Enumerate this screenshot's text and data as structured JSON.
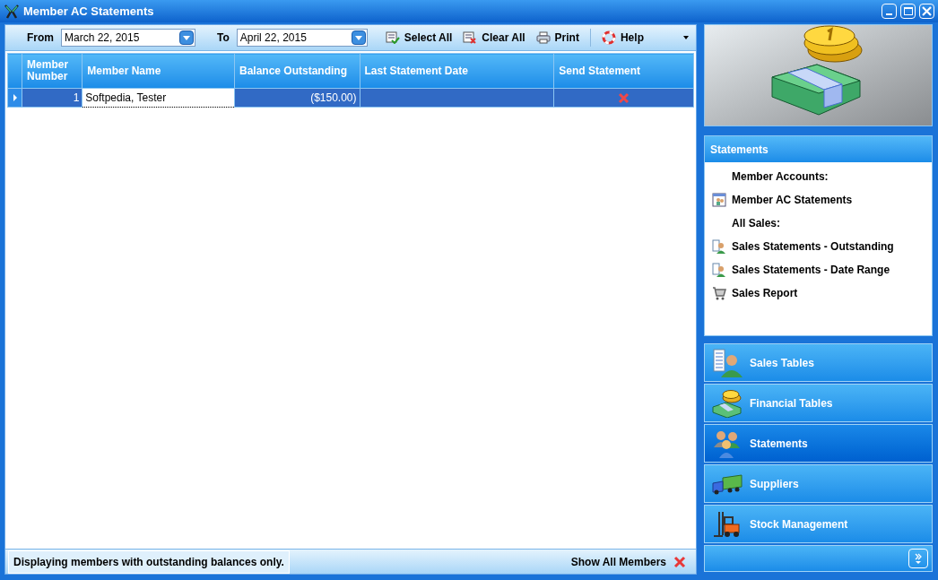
{
  "window": {
    "title": "Member AC Statements"
  },
  "toolbar": {
    "from_label": "From",
    "from_value": "March 22, 2015",
    "to_label": "To",
    "to_value": "April 22, 2015",
    "buttons": [
      {
        "kind": "select",
        "label": "Select All"
      },
      {
        "kind": "clear",
        "label": "Clear All"
      },
      {
        "kind": "print",
        "label": "Print"
      },
      {
        "kind": "help",
        "label": "Help"
      }
    ]
  },
  "table": {
    "columns": [
      "Member Number",
      "Member Name",
      "Balance Outstanding",
      "Last Statement Date",
      "Send Statement"
    ],
    "rows": [
      {
        "selected": true,
        "member_number": "1",
        "member_name": "Softpedia, Tester",
        "balance": "($150.00)",
        "last_statement_date": "",
        "send_statement": false
      }
    ]
  },
  "status_bar": {
    "message": "Displaying members with outstanding balances only.",
    "show_all": "Show All Members"
  },
  "statements_panel": {
    "title": "Statements",
    "items": [
      {
        "kind": "heading",
        "label": "Member Accounts:"
      },
      {
        "kind": "statement",
        "label": "Member AC Statements"
      },
      {
        "kind": "heading",
        "label": "All Sales:"
      },
      {
        "kind": "sales",
        "label": "Sales Statements - Outstanding"
      },
      {
        "kind": "sales",
        "label": "Sales Statements - Date Range"
      },
      {
        "kind": "cart",
        "label": "Sales Report"
      }
    ]
  },
  "nav_buttons": [
    {
      "kind": "sales",
      "label": "Sales Tables",
      "selected": false
    },
    {
      "kind": "money",
      "label": "Financial Tables",
      "selected": false
    },
    {
      "kind": "people",
      "label": "Statements",
      "selected": true
    },
    {
      "kind": "truck",
      "label": "Suppliers",
      "selected": false
    },
    {
      "kind": "forklift",
      "label": "Stock Management",
      "selected": false
    }
  ]
}
